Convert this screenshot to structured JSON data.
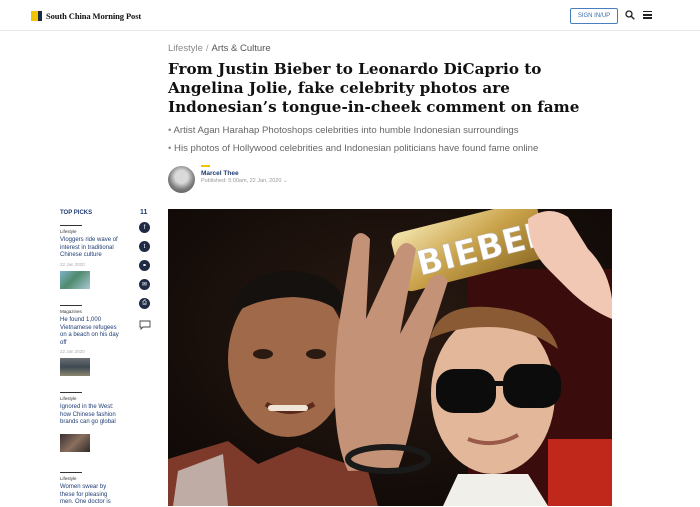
{
  "header": {
    "logo_text": "South China Morning Post",
    "signin_label": "SIGN IN/UP",
    "search_icon": "search-icon",
    "menu_icon": "hamburger-menu-icon"
  },
  "breadcrumb": {
    "section": "Lifestyle",
    "separator": "/",
    "subsection": "Arts & Culture"
  },
  "article": {
    "headline": "From Justin Bieber to Leonardo DiCaprio to Angelina Jolie, fake celebrity photos are Indonesian’s tongue-in-cheek comment on fame",
    "bullets": [
      "Artist Agan Harahap Photoshops celebrities into humble Indonesian surroundings",
      "His photos of Hollywood celebrities and Indonesian politicians have found fame online"
    ],
    "author": "Marcel Thee",
    "published": "Published: 5:00am, 22 Jan, 2020 ⌄",
    "hero_text": "BIEBER"
  },
  "top_picks": {
    "heading": "TOP PICKS",
    "items": [
      {
        "section": "Lifestyle",
        "title": "Vloggers ride wave of interest in traditional Chinese culture",
        "date": "22 Jan 2020"
      },
      {
        "section": "Magazines",
        "title": "He found 1,000 Vietnamese refugees on a beach on his day off",
        "date": "22 Jan 2020"
      },
      {
        "section": "Lifestyle",
        "title": "Ignored in the West: how Chinese fashion brands can go global",
        "date": "22 Jan 2020"
      },
      {
        "section": "Lifestyle",
        "title": "Women swear by these for pleasing men. One doctor is",
        "date": ""
      }
    ]
  },
  "share": {
    "count": "11",
    "icons": [
      "facebook-icon",
      "twitter-icon",
      "link-icon",
      "email-icon",
      "print-icon",
      "comment-icon"
    ],
    "glyphs": [
      "f",
      "t",
      "⚭",
      "✉",
      "⎙"
    ]
  },
  "colors": {
    "brand_yellow": "#f2c300",
    "brand_navy": "#1f2a44",
    "link_blue": "#1f3c74"
  }
}
